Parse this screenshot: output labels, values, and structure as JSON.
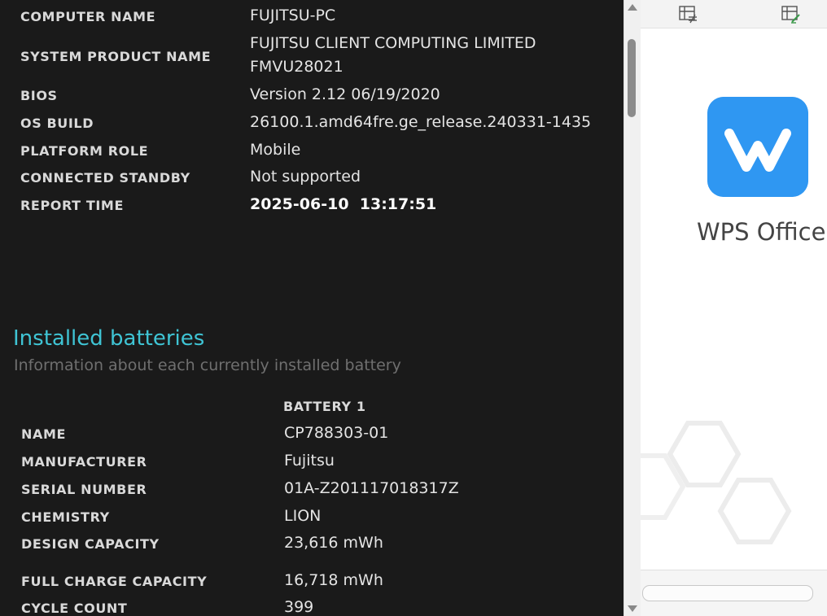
{
  "system_info": [
    {
      "label": "COMPUTER NAME",
      "value": [
        "FUJITSU-PC"
      ]
    },
    {
      "label": "SYSTEM PRODUCT NAME",
      "value": [
        "FUJITSU CLIENT COMPUTING LIMITED",
        "FMVU28021"
      ]
    },
    {
      "label": "BIOS",
      "value": [
        "Version 2.12 06/19/2020"
      ]
    },
    {
      "label": "OS BUILD",
      "value": [
        "26100.1.amd64fre.ge_release.240331-1435"
      ]
    },
    {
      "label": "PLATFORM ROLE",
      "value": [
        "Mobile"
      ]
    },
    {
      "label": "CONNECTED STANDBY",
      "value": [
        "Not supported"
      ]
    },
    {
      "label": "REPORT TIME",
      "value": [
        "2025-06-10  13:17:51"
      ]
    }
  ],
  "installed_batteries": {
    "title": "Installed batteries",
    "subtitle": "Information about each currently installed battery",
    "column_header": "BATTERY 1",
    "rows": [
      {
        "label": "NAME",
        "value": "CP788303-01"
      },
      {
        "label": "MANUFACTURER",
        "value": "Fujitsu"
      },
      {
        "label": "SERIAL NUMBER",
        "value": "01A-Z201117018317Z"
      },
      {
        "label": "CHEMISTRY",
        "value": "LION"
      },
      {
        "label": "DESIGN CAPACITY",
        "value": "23,616 mWh"
      },
      {
        "label": "FULL CHARGE CAPACITY",
        "value": "16,718 mWh"
      },
      {
        "label": "CYCLE COUNT",
        "value": "399"
      }
    ]
  },
  "right_panel": {
    "app_name": "WPS Office",
    "toolbar_icons": [
      "table-not-equal-icon",
      "table-edit-icon"
    ],
    "logo_icon": "wps-logo-icon",
    "accent_color": "#2f97f2"
  },
  "colors": {
    "background": "#1a1a1a",
    "section_title": "#3fc4d4",
    "subtitle": "#6f6f6f"
  }
}
